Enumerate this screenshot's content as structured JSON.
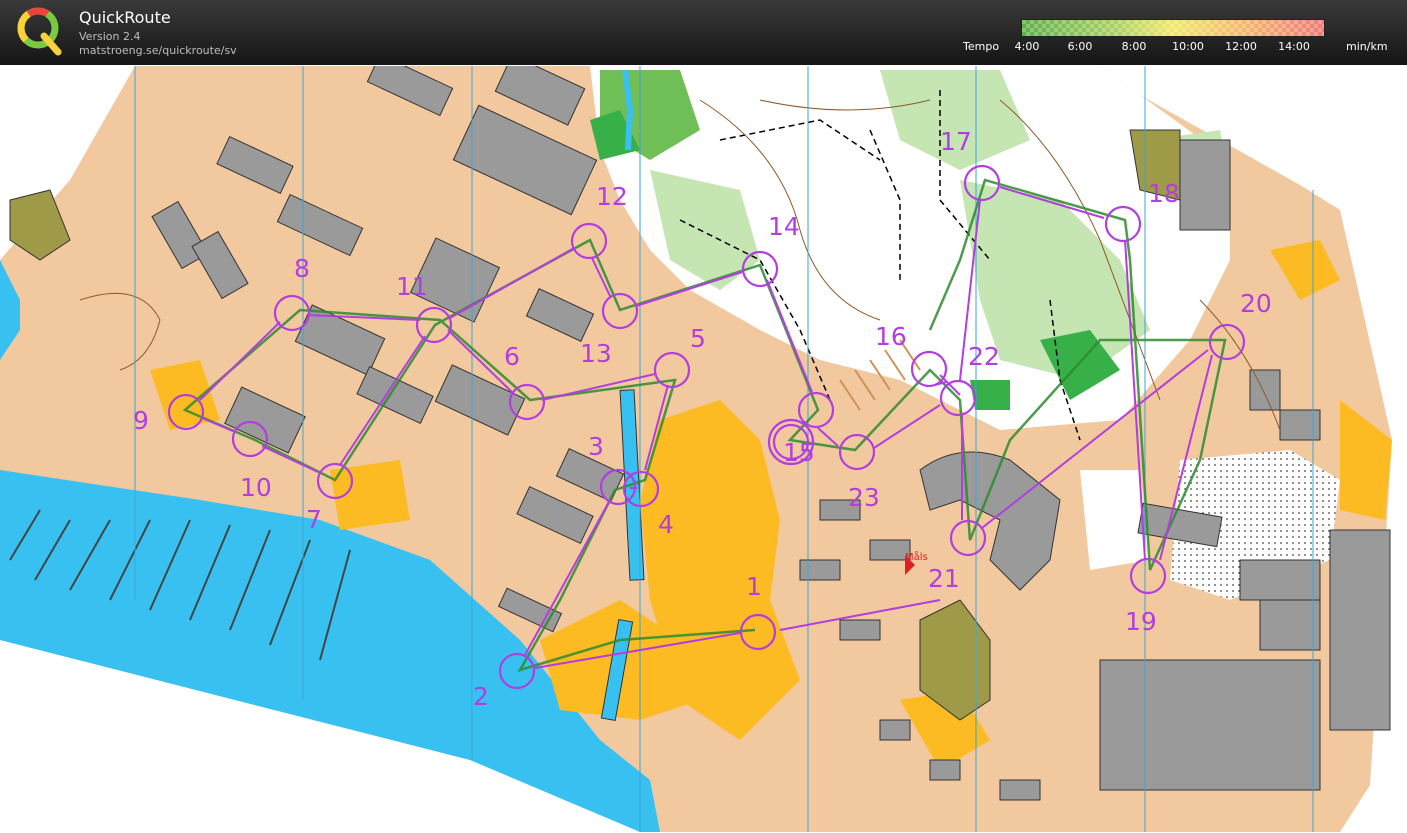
{
  "app": {
    "name": "QuickRoute",
    "version": "Version 2.4",
    "url": "matstroeng.se/quickroute/sv"
  },
  "tempo": {
    "label": "Tempo",
    "ticks": [
      "4:00",
      "6:00",
      "8:00",
      "10:00",
      "12:00",
      "14:00"
    ],
    "unit": "min/km",
    "colors": [
      "#5fb04a",
      "#a8d064",
      "#f2e86a",
      "#f3b56e",
      "#ef7a7a"
    ]
  },
  "map": {
    "course_color": "#b33ee0",
    "route_color": "#2e8b2e",
    "controls": [
      "1",
      "2",
      "3",
      "4",
      "5",
      "6",
      "7",
      "8",
      "9",
      "10",
      "11",
      "12",
      "13",
      "14",
      "15",
      "16",
      "17",
      "18",
      "19",
      "20",
      "21",
      "22",
      "23"
    ],
    "finish_label": "Måls"
  }
}
